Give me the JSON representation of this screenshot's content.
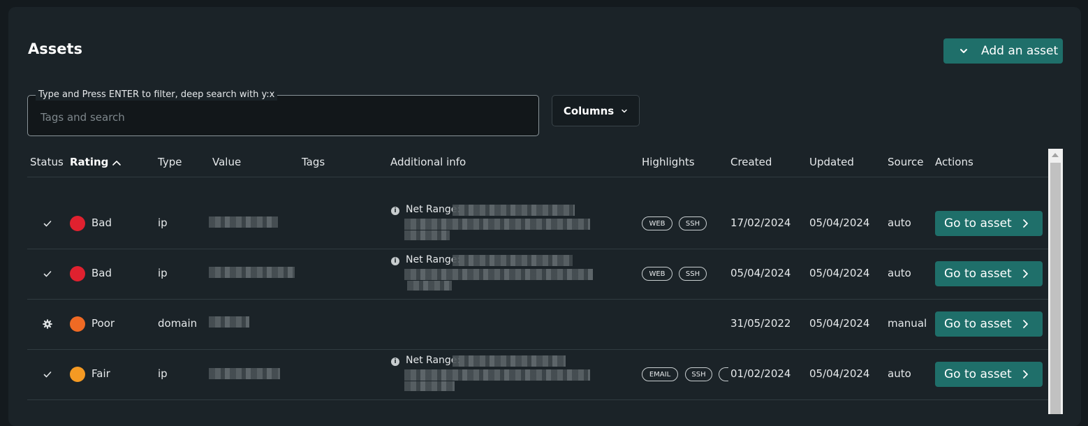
{
  "header": {
    "title": "Assets",
    "add_button_label": "Add an asset"
  },
  "search": {
    "legend": "Type and Press ENTER to filter, deep search with y:x",
    "placeholder": "Tags and search",
    "value": ""
  },
  "columns_button_label": "Columns",
  "table": {
    "columns": [
      "Status",
      "Rating",
      "Type",
      "Value",
      "Tags",
      "Additional info",
      "Highlights",
      "Created",
      "Updated",
      "Source",
      "Actions"
    ],
    "sorted_by": "Rating",
    "sort_direction": "ascending",
    "rows": [
      {
        "status_icon": "check-icon",
        "rating": "Bad",
        "rating_color": "#e0212f",
        "type": "ip",
        "info_label": "Net Range:",
        "highlights": [
          "WEB",
          "SSH"
        ],
        "created": "17/02/2024",
        "updated": "05/04/2024",
        "source": "auto",
        "action_label": "Go to asset"
      },
      {
        "status_icon": "check-icon",
        "rating": "Bad",
        "rating_color": "#e0212f",
        "type": "ip",
        "info_label": "Net Range:",
        "highlights": [
          "WEB",
          "SSH"
        ],
        "created": "05/04/2024",
        "updated": "05/04/2024",
        "source": "auto",
        "action_label": "Go to asset"
      },
      {
        "status_icon": "gear-icon",
        "rating": "Poor",
        "rating_color": "#f06a24",
        "type": "domain",
        "info_label": "",
        "highlights": [],
        "created": "31/05/2022",
        "updated": "05/04/2024",
        "source": "manual",
        "action_label": "Go to asset"
      },
      {
        "status_icon": "check-icon",
        "rating": "Fair",
        "rating_color": "#f59a23",
        "type": "ip",
        "info_label": "Net Range:",
        "highlights": [
          "EMAIL",
          "SSH"
        ],
        "created": "01/02/2024",
        "updated": "05/04/2024",
        "source": "auto",
        "action_label": "Go to asset"
      }
    ]
  },
  "colors": {
    "background": "#141a1e",
    "card": "#1b2328",
    "accent": "#1f6f6a",
    "rating_bad": "#e0212f",
    "rating_poor": "#f06a24",
    "rating_fair": "#f59a23"
  }
}
